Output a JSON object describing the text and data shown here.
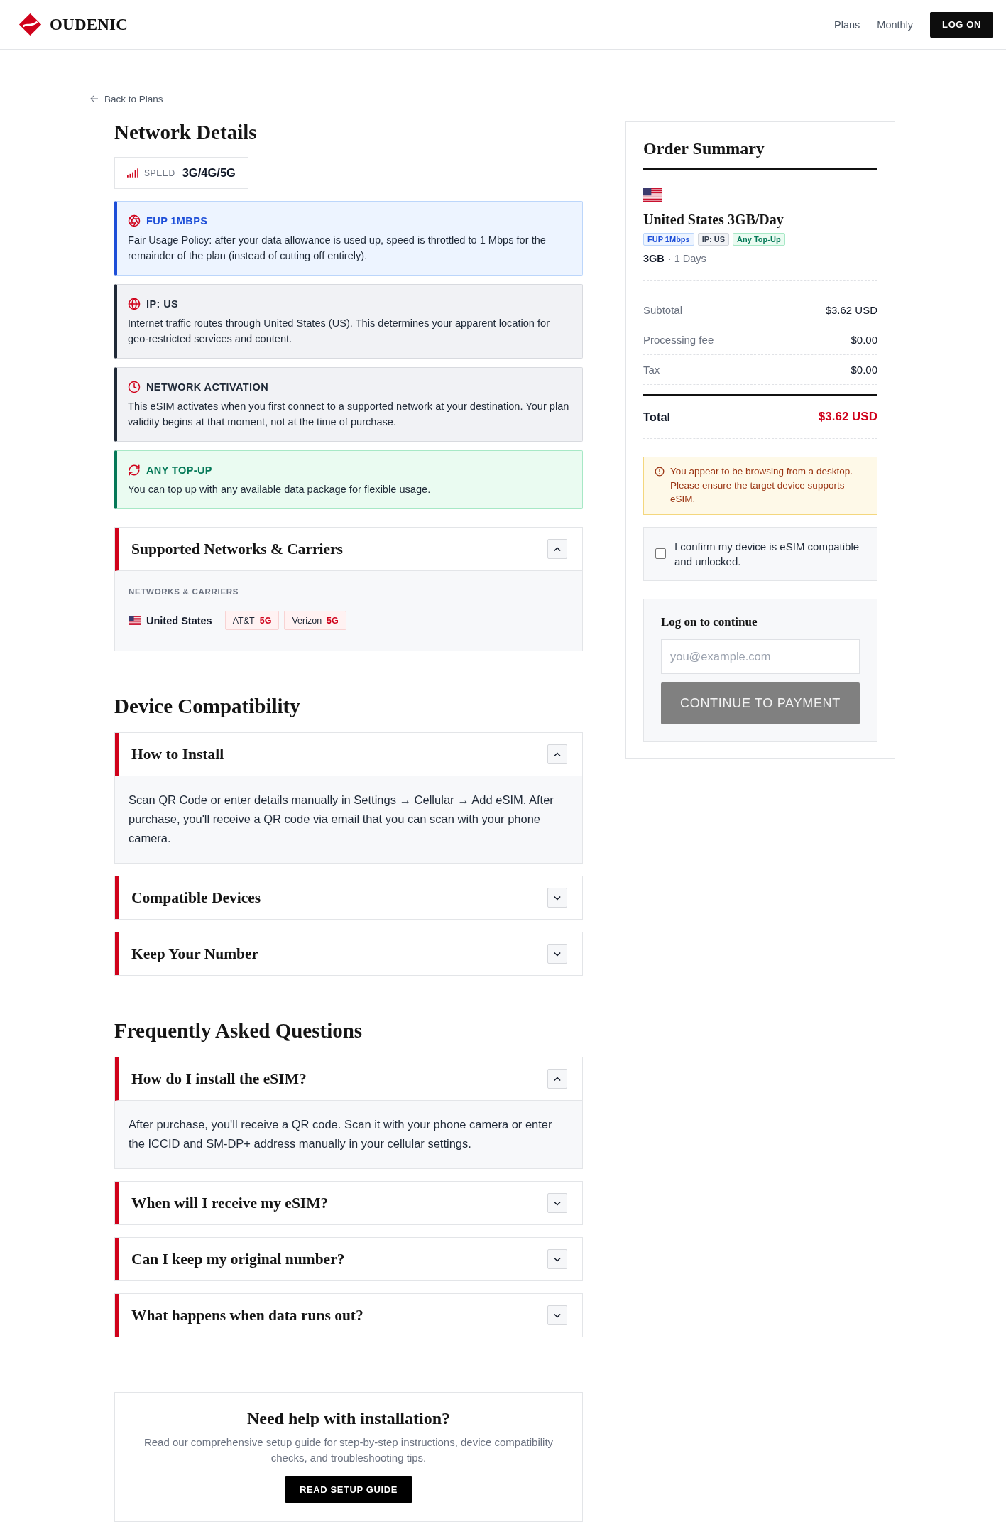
{
  "header": {
    "brand": "OUDENIC",
    "nav": [
      {
        "label": "Plans"
      },
      {
        "label": "Monthly"
      }
    ],
    "login_button": "LOG ON"
  },
  "back_link": "Back to Plans",
  "network_details": {
    "title": "Network Details",
    "speed": {
      "label": "SPEED",
      "value": "3G/4G/5G"
    },
    "features": [
      {
        "kind": "fup",
        "title": "FUP 1MBPS",
        "text": "Fair Usage Policy: after your data allowance is used up, speed is throttled to 1 Mbps for the remainder of the plan (instead of cutting off entirely)."
      },
      {
        "kind": "ip",
        "title": "IP: US",
        "text": "Internet traffic routes through United States (US). This determines your apparent location for geo-restricted services and content."
      },
      {
        "kind": "activation",
        "title": "NETWORK ACTIVATION",
        "text": "This eSIM activates when you first connect to a supported network at your destination. Your plan validity begins at that moment, not at the time of purchase."
      },
      {
        "kind": "topup",
        "title": "ANY TOP-UP",
        "text": "You can top up with any available data package for flexible usage."
      }
    ],
    "carriers_panel": {
      "title": "Supported Networks & Carriers",
      "expanded": true,
      "section_label": "NETWORKS & CARRIERS",
      "countries": [
        {
          "name": "United States",
          "carriers": [
            {
              "name": "AT&T",
              "network": "5G"
            },
            {
              "name": "Verizon",
              "network": "5G"
            }
          ]
        }
      ]
    }
  },
  "device_compatibility": {
    "title": "Device Compatibility",
    "items": [
      {
        "title": "How to Install",
        "expanded": true,
        "body": "Scan QR Code or enter details manually in Settings → Cellular → Add eSIM. After purchase, you'll receive a QR code via email that you can scan with your phone camera."
      },
      {
        "title": "Compatible Devices",
        "expanded": false
      },
      {
        "title": "Keep Your Number",
        "expanded": false
      }
    ]
  },
  "faq": {
    "title": "Frequently Asked Questions",
    "items": [
      {
        "title": "How do I install the eSIM?",
        "expanded": true,
        "body": "After purchase, you'll receive a QR code. Scan it with your phone camera or enter the ICCID and SM-DP+ address manually in your cellular settings."
      },
      {
        "title": "When will I receive my eSIM?",
        "expanded": false
      },
      {
        "title": "Can I keep my original number?",
        "expanded": false
      },
      {
        "title": "What happens when data runs out?",
        "expanded": false
      }
    ]
  },
  "help": {
    "title": "Need help with installation?",
    "text": "Read our comprehensive setup guide for step-by-step instructions, device compatibility checks, and troubleshooting tips.",
    "button": "READ SETUP GUIDE"
  },
  "order_summary": {
    "title": "Order Summary",
    "plan_name": "United States 3GB/Day",
    "tags": [
      {
        "kind": "fup",
        "label": "FUP 1Mbps"
      },
      {
        "kind": "ip",
        "label": "IP: US"
      },
      {
        "kind": "topup",
        "label": "Any Top-Up"
      }
    ],
    "data": "3GB",
    "duration": "· 1 Days",
    "lines": [
      {
        "label": "Subtotal",
        "amount": "$3.62 USD"
      },
      {
        "label": "Processing fee",
        "amount": "$0.00"
      },
      {
        "label": "Tax",
        "amount": "$0.00"
      }
    ],
    "total": {
      "label": "Total",
      "amount": "$3.62 USD"
    },
    "warning": "You appear to be browsing from a desktop. Please ensure the target device supports eSIM.",
    "confirm": {
      "label": "I confirm my device is eSIM compatible and unlocked.",
      "checked": false
    },
    "login": {
      "title": "Log on to continue",
      "email_placeholder": "you@example.com",
      "button": {
        "label": "CONTINUE TO PAYMENT",
        "disabled": true
      }
    }
  }
}
